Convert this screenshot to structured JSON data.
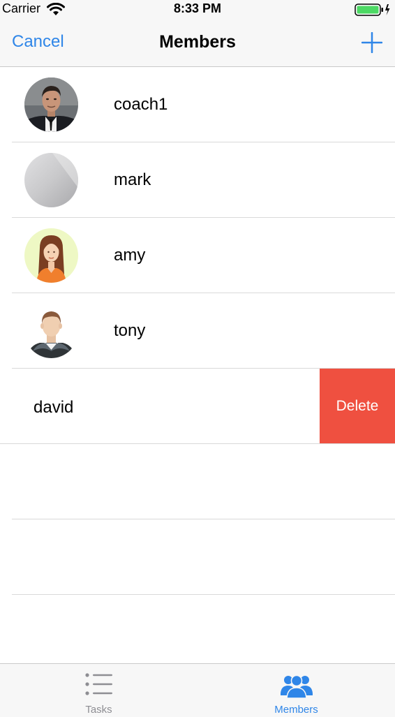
{
  "status_bar": {
    "carrier": "Carrier",
    "time": "8:33 PM",
    "battery_color": "#4cd964"
  },
  "nav": {
    "cancel_label": "Cancel",
    "title": "Members",
    "accent_color": "#2f86e8"
  },
  "members": [
    {
      "name": "coach1",
      "avatar": "person-photo-icon"
    },
    {
      "name": "mark",
      "avatar": "blurred-photo-icon"
    },
    {
      "name": "amy",
      "avatar": "woman-cartoon-icon"
    },
    {
      "name": "tony",
      "avatar": "man-cartoon-icon"
    }
  ],
  "swiped_row": {
    "name": "david",
    "delete_label": "Delete",
    "delete_color": "#ef5040"
  },
  "tab_bar": {
    "tabs": [
      {
        "label": "Tasks",
        "icon": "list-icon",
        "active": false
      },
      {
        "label": "Members",
        "icon": "people-icon",
        "active": true
      }
    ],
    "active_color": "#2f86e8",
    "inactive_color": "#8e8e93"
  }
}
